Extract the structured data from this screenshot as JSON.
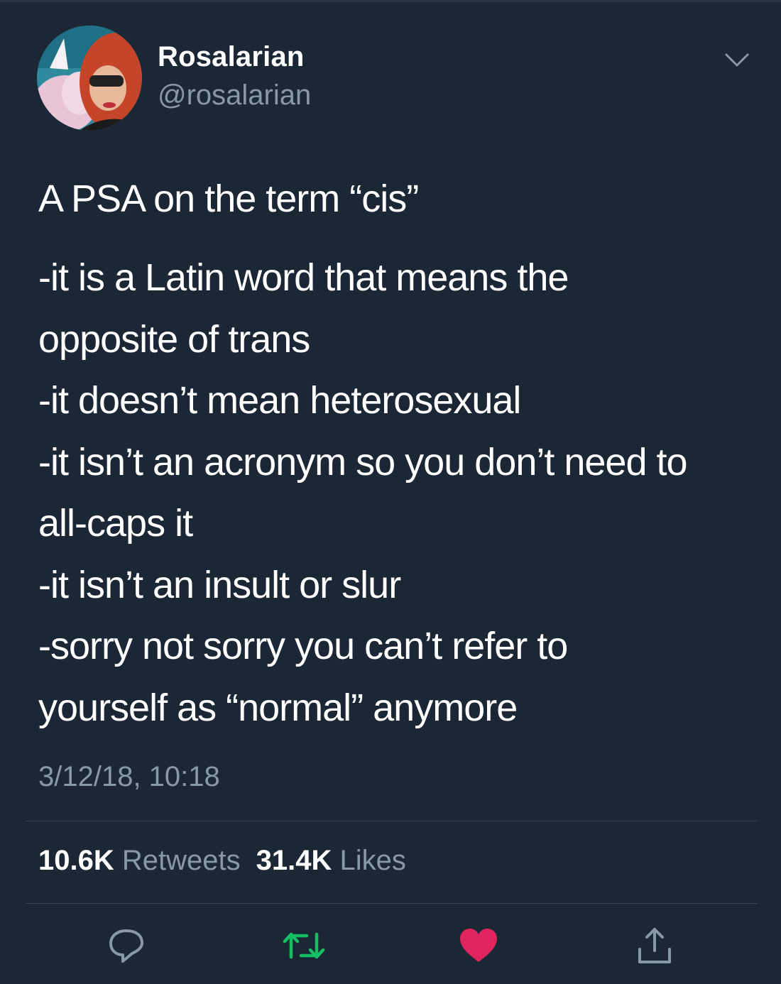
{
  "user": {
    "name": "Rosalarian",
    "handle": "@rosalarian"
  },
  "tweet": {
    "title": "A PSA on the term “cis”",
    "lines": [
      "-it is a Latin word that means the",
      "opposite of trans",
      "-it doesn’t mean heterosexual",
      "-it isn’t an acronym so you don’t need to",
      "all-caps it",
      "-it isn’t an insult or slur",
      "-sorry not sorry you can’t refer to",
      "yourself as “normal” anymore"
    ],
    "timestamp": "3/12/18, 10:18"
  },
  "stats": {
    "retweets_count": "10.6K",
    "retweets_label": "Retweets",
    "likes_count": "31.4K",
    "likes_label": "Likes"
  },
  "actions": {
    "reply_icon": "reply-icon",
    "retweet_icon": "retweet-icon",
    "like_icon": "heart-icon",
    "share_icon": "share-icon"
  },
  "colors": {
    "background": "#1c2735",
    "text": "#ffffff",
    "secondary_text": "#8899a6",
    "divider": "#38444d",
    "retweet_active": "#17bf63",
    "like_active": "#e0245e"
  }
}
